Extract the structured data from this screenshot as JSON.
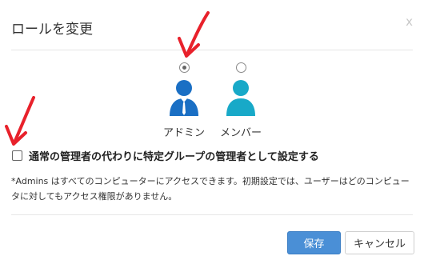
{
  "dialog": {
    "title": "ロールを変更",
    "close_label": "x"
  },
  "roles": {
    "admin": {
      "label": "アドミン",
      "selected": true,
      "color": "#1a6fc4"
    },
    "member": {
      "label": "メンバー",
      "selected": false,
      "color": "#18a9c8"
    }
  },
  "checkbox": {
    "label": "通常の管理者の代わりに特定グループの管理者として設定する",
    "checked": false
  },
  "note": "*Admins はすべてのコンピューターにアクセスできます。初期設定では、ユーザーはどのコンピュータに対してもアクセス権限がありません。",
  "buttons": {
    "save_label": "保存",
    "cancel_label": "キャンセル",
    "save_color": "#4a8fd6"
  },
  "annotations": {
    "arrow_color": "#e8212b"
  }
}
